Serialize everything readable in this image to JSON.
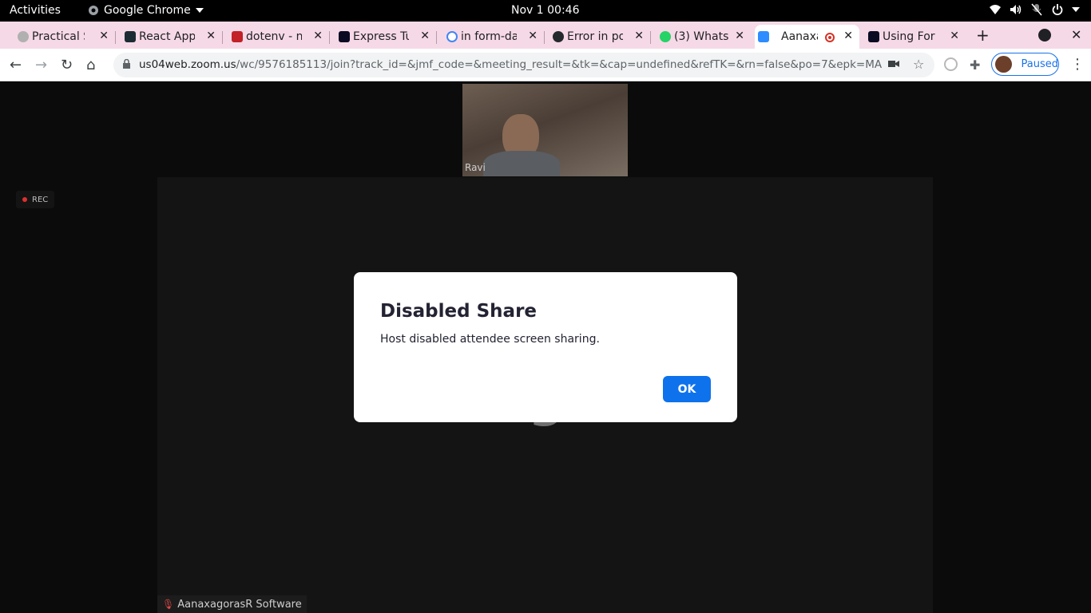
{
  "topbar": {
    "activities": "Activities",
    "app_name": "Google Chrome",
    "clock": "Nov 1  00:46",
    "tray_icons": [
      "wifi-icon",
      "volume-icon",
      "mic-muted-icon",
      "power-icon"
    ]
  },
  "tabs": [
    {
      "label": "Practical S",
      "favicon": "practical-icon",
      "color": "#8a8a8a"
    },
    {
      "label": "React App",
      "favicon": "react-icon",
      "color": "#1b2b34"
    },
    {
      "label": "dotenv - n",
      "favicon": "npm-icon",
      "color": "#c12127"
    },
    {
      "label": "Express Tu",
      "favicon": "freecodecamp-icon",
      "color": "#0a0a23"
    },
    {
      "label": "in form-da",
      "favicon": "google-icon",
      "color": "#4285f4"
    },
    {
      "label": "Error in po",
      "favicon": "github-icon",
      "color": "#24292e"
    },
    {
      "label": "(3) Whats",
      "favicon": "whatsapp-icon",
      "color": "#25d366",
      "badge": "3"
    },
    {
      "label": "Aanaxa",
      "favicon": "zoom-icon",
      "color": "#2d8cff",
      "active": true,
      "recording": true
    },
    {
      "label": "Using For",
      "favicon": "freecodecamp-icon",
      "color": "#0a0a23"
    }
  ],
  "toolbar": {
    "url_host": "us04web.zoom.us",
    "url_path": "/wc/9576185113/join?track_id=&jmf_code=&meeting_result=&tk=&cap=undefined&refTK=&rn=false&po=7&epk=MAO8xoiPt...",
    "profile_status": "Paused"
  },
  "meeting": {
    "participant_name": "Ravi",
    "rec_label": "REC",
    "share_title": "AanaxagorasR Software",
    "share_source": "AanaxagorasR Software",
    "share_title_visible": "Aana   g            ware"
  },
  "dialog": {
    "title": "Disabled Share",
    "message": "Host disabled attendee screen sharing.",
    "ok_label": "OK"
  },
  "colors": {
    "tabstrip": "#f6d9e6",
    "zoom_blue": "#0e72ed",
    "stage_bg": "#0b0b0b"
  }
}
